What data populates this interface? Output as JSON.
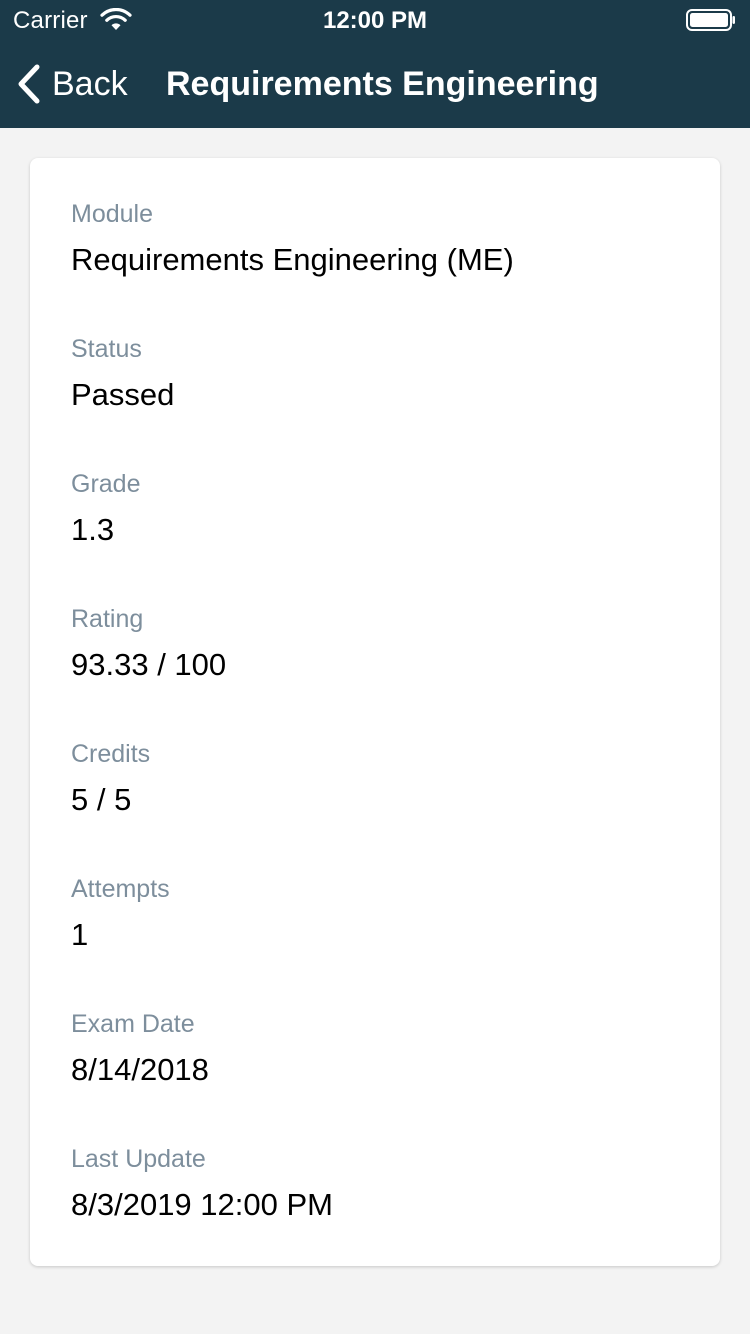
{
  "status_bar": {
    "carrier": "Carrier",
    "time": "12:00 PM"
  },
  "nav": {
    "back_label": "Back",
    "title": "Requirements Engineering"
  },
  "details": [
    {
      "label": "Module",
      "value": "Requirements Engineering (ME)"
    },
    {
      "label": "Status",
      "value": "Passed"
    },
    {
      "label": "Grade",
      "value": "1.3"
    },
    {
      "label": "Rating",
      "value": "93.33 / 100"
    },
    {
      "label": "Credits",
      "value": "5 / 5"
    },
    {
      "label": "Attempts",
      "value": "1"
    },
    {
      "label": "Exam Date",
      "value": "8/14/2018"
    },
    {
      "label": "Last Update",
      "value": "8/3/2019 12:00 PM"
    }
  ],
  "colors": {
    "nav_background": "#1b3a49",
    "page_background": "#f3f3f3",
    "label_text": "#7d8e9c",
    "value_text": "#000000"
  },
  "icons": {
    "wifi": "wifi-icon",
    "battery": "battery-icon",
    "back": "chevron-left-icon"
  }
}
